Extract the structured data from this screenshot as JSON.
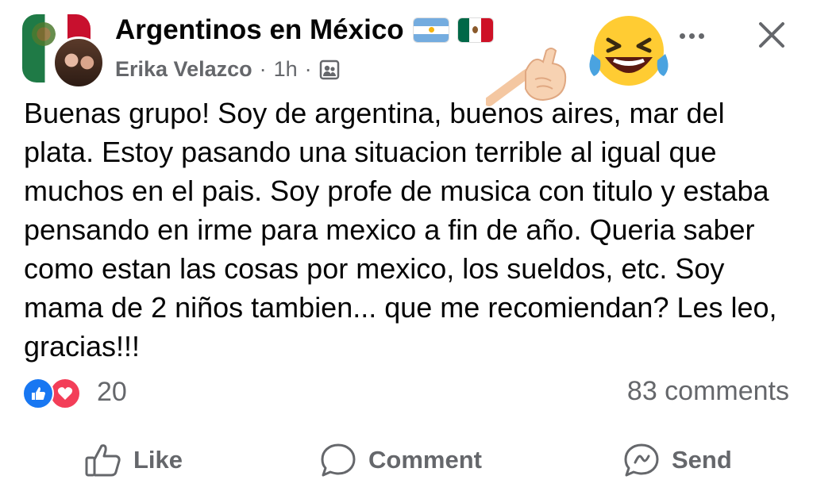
{
  "post": {
    "group_name": "Argentinos en México",
    "author": "Erika Velazco",
    "separator": "·",
    "time": "1h",
    "audience_icon": "group-members-icon",
    "text": "Buenas grupo! Soy de argentina, buenos aires, mar del plata. Estoy pasando una situacion terrible al igual que muchos en el pais. Soy profe de musica con titulo y estaba pensando en irme para mexico a fin de año. Queria saber como estan las cosas por mexico, los sueldos, etc. Soy mama de 2 niños tambien... que me recomiendan? Les leo, gracias!!!"
  },
  "reactions": {
    "count": "20",
    "types": [
      "like",
      "love"
    ],
    "comments_label": "83 comments"
  },
  "actions": {
    "like_label": "Like",
    "comment_label": "Comment",
    "send_label": "Send"
  },
  "overlay": {
    "pointing_emoji": "pointing-hand-icon",
    "laughing_emoji": "tears-of-joy-icon"
  },
  "colors": {
    "secondary_text": "#65676b",
    "like_blue": "#1877f2",
    "love_red": "#f33e58",
    "primary_text": "#050505"
  }
}
